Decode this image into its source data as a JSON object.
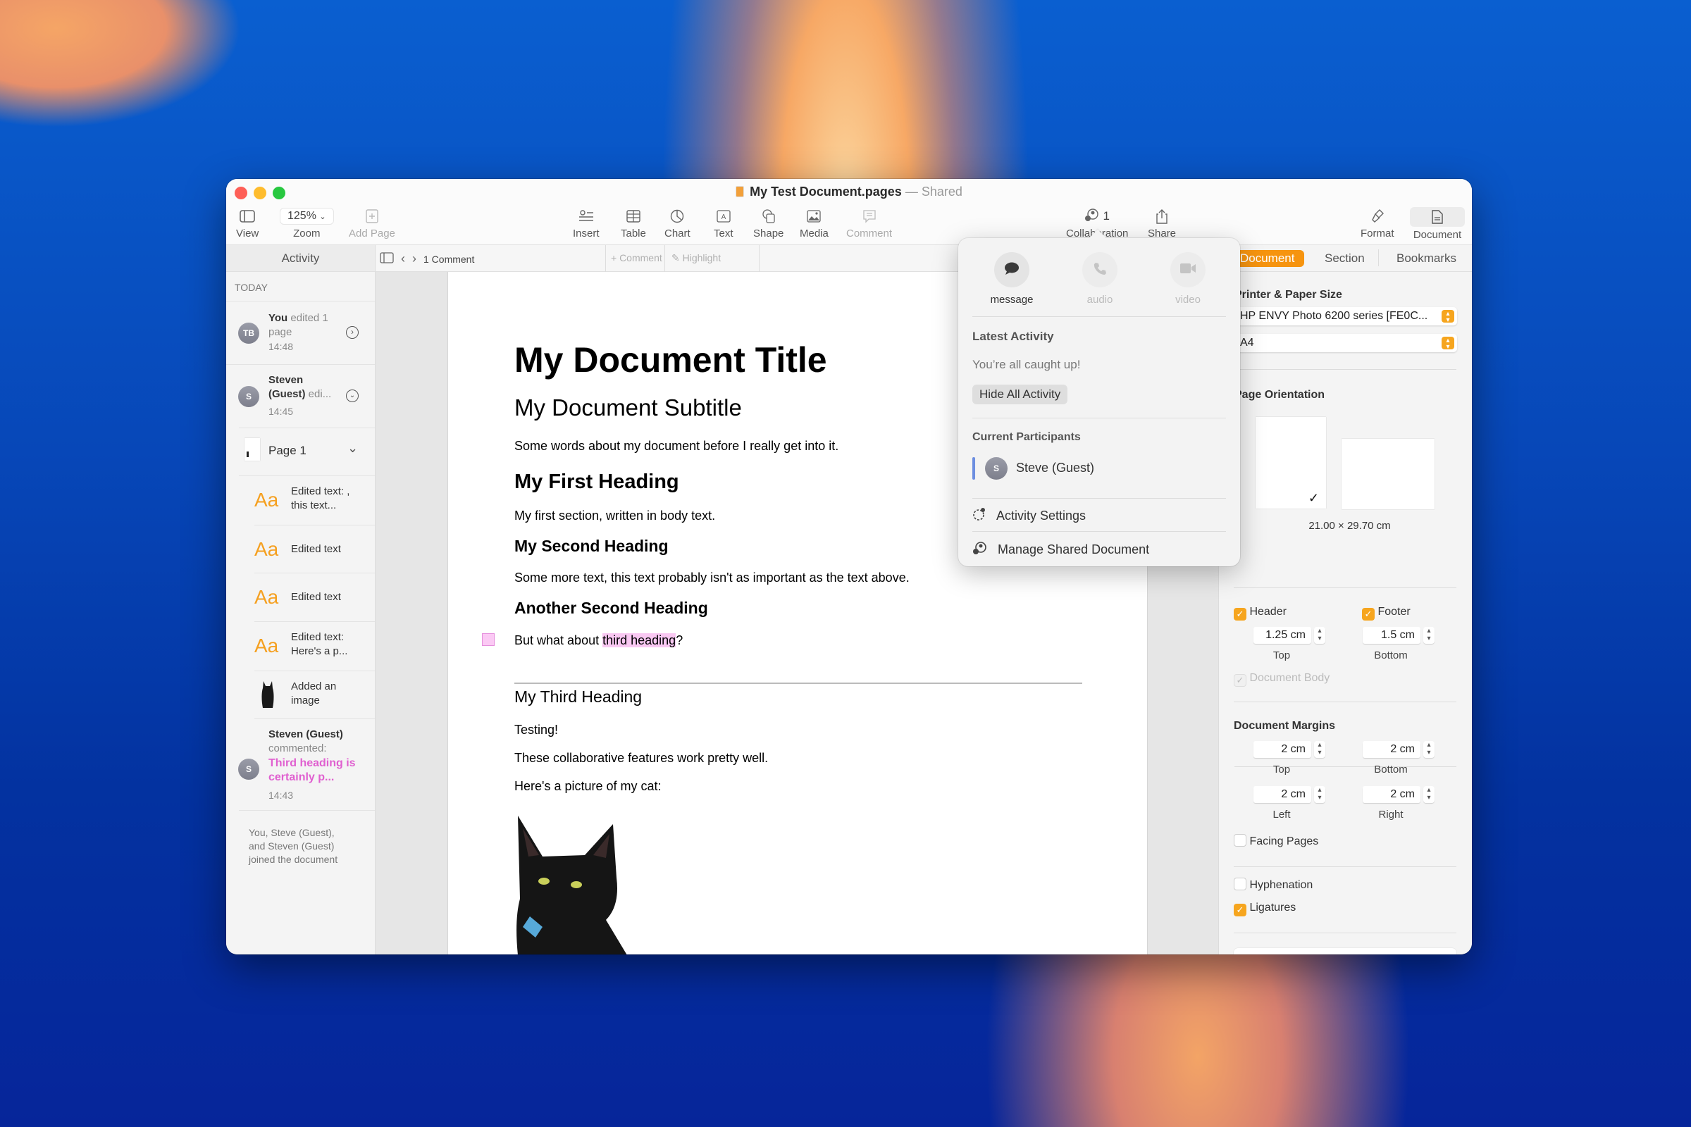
{
  "window": {
    "title": "My Test Document.pages",
    "title_separator": "—",
    "title_status": "Shared"
  },
  "toolbar": {
    "view": "View",
    "zoom_value": "125%",
    "zoom": "Zoom",
    "add_page": "Add Page",
    "insert": "Insert",
    "table": "Table",
    "chart": "Chart",
    "text": "Text",
    "shape": "Shape",
    "media": "Media",
    "comment": "Comment",
    "collaboration": "Collaboration",
    "collaboration_count": "1",
    "share": "Share",
    "format": "Format",
    "document": "Document"
  },
  "subbar": {
    "comments_count": "1 Comment",
    "add_comment": "+ Comment",
    "highlight": "Highlight"
  },
  "sidebar": {
    "title": "Activity",
    "section": "TODAY",
    "items": [
      {
        "avatar": "TB",
        "name": "You",
        "action": "edited 1 page",
        "time": "14:48"
      },
      {
        "avatar": "S",
        "name": "Steven (Guest)",
        "action": "edi...",
        "time": "14:45"
      },
      {
        "label": "Page 1"
      },
      {
        "icon": "Aa",
        "text": "Edited text: , this text..."
      },
      {
        "icon": "Aa",
        "text": "Edited text"
      },
      {
        "icon": "Aa",
        "text": "Edited text"
      },
      {
        "icon": "Aa",
        "text": "Edited text: Here's a p..."
      },
      {
        "icon": "cat-thumbnail",
        "text": "Added an image"
      },
      {
        "avatar": "S",
        "name": "Steven (Guest)",
        "action": "commented:",
        "comment": "Third heading is certainly p...",
        "time": "14:43"
      }
    ],
    "joined": "You, Steve (Guest), and Steven (Guest) joined the document"
  },
  "document": {
    "title": "My Document Title",
    "subtitle": "My Document Subtitle",
    "intro": "Some words about my document before I really get into it.",
    "h1": "My First Heading",
    "p1": "My first section, written in body text.",
    "h2a": "My Second Heading",
    "p2": "Some more text, this text probably isn't as important as the text above.",
    "h2b": "Another Second Heading",
    "p3_pre": "But what about ",
    "p3_highlight": "third heading",
    "p3_post": "?",
    "h3": "My Third Heading",
    "p4": "Testing!",
    "p5": "These collaborative features work pretty well.",
    "p6": "Here's a picture of my cat:"
  },
  "collab_popup": {
    "message": "message",
    "audio": "audio",
    "video": "video",
    "latest_activity": "Latest Activity",
    "caught_up": "You’re all caught up!",
    "hide_all": "Hide All Activity",
    "current_participants": "Current Participants",
    "participant": {
      "avatar": "S",
      "name": "Steve (Guest)"
    },
    "activity_settings": "Activity Settings",
    "manage_shared": "Manage Shared Document"
  },
  "inspector": {
    "tabs": [
      "Document",
      "Section",
      "Bookmarks"
    ],
    "active_tab": "Document",
    "printer_paper_label": "Printer & Paper Size",
    "printer": "HP ENVY Photo 6200 series [FE0C...",
    "paper": "A4",
    "orientation_label": "Page Orientation",
    "paper_dims": "21.00 × 29.70 cm",
    "header": {
      "label": "Header",
      "checked": true,
      "value": "1.25 cm",
      "sub": "Top"
    },
    "footer": {
      "label": "Footer",
      "checked": true,
      "value": "1.5 cm",
      "sub": "Bottom"
    },
    "document_body": {
      "label": "Document Body",
      "checked": true,
      "disabled": true
    },
    "margins_label": "Document Margins",
    "margins": {
      "top": {
        "value": "2 cm",
        "label": "Top"
      },
      "bottom": {
        "value": "2 cm",
        "label": "Bottom"
      },
      "left": {
        "value": "2 cm",
        "label": "Left"
      },
      "right": {
        "value": "2 cm",
        "label": "Right"
      }
    },
    "facing_pages": {
      "label": "Facing Pages",
      "checked": false
    },
    "hyphenation": {
      "label": "Hyphenation",
      "checked": false
    },
    "ligatures": {
      "label": "Ligatures",
      "checked": true
    }
  },
  "colors": {
    "accent": "#f6a51e",
    "comment_pink": "#e060d0",
    "highlight_pink": "#f9c8f2"
  }
}
